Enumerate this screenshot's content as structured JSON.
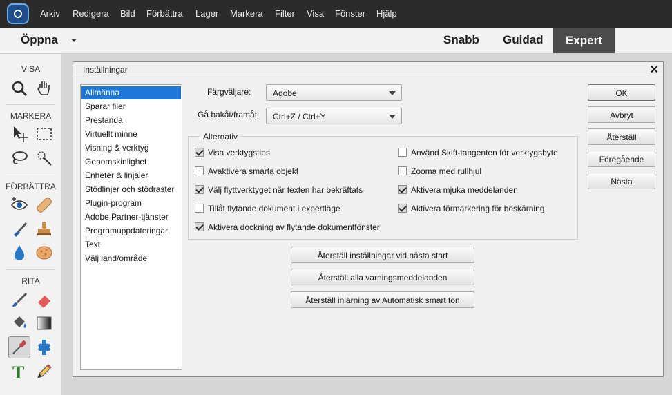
{
  "menubar": {
    "items": [
      "Arkiv",
      "Redigera",
      "Bild",
      "Förbättra",
      "Lager",
      "Markera",
      "Filter",
      "Visa",
      "Fönster",
      "Hjälp"
    ]
  },
  "modebar": {
    "open_label": "Öppna",
    "tabs": [
      "Snabb",
      "Guidad",
      "Expert"
    ],
    "active_tab": "Expert"
  },
  "toolbar": {
    "sections": [
      "VISA",
      "MARKERA",
      "FÖRBÄTTRA",
      "RITA"
    ],
    "tools": [
      "zoom",
      "hand",
      "move",
      "rectangular-marquee",
      "lasso",
      "quick-selection",
      "red-eye",
      "spot-healing",
      "smart-brush",
      "clone-stamp",
      "blur",
      "sponge",
      "brush",
      "eraser",
      "paint-bucket",
      "gradient",
      "color-picker",
      "custom-shape",
      "type",
      "pencil"
    ],
    "selected_tool": "color-picker"
  },
  "dialog": {
    "title": "Inställningar",
    "categories": [
      "Allmänna",
      "Sparar filer",
      "Prestanda",
      "Virtuellt minne",
      "Visning & verktyg",
      "Genomskinlighet",
      "Enheter & linjaler",
      "Stödlinjer och stödraster",
      "Plugin-program",
      "Adobe Partner-tjänster",
      "Programuppdateringar",
      "Text",
      "Välj land/område"
    ],
    "selected_category": "Allmänna",
    "color_picker_label": "Färgväljare:",
    "color_picker_value": "Adobe",
    "undo_label": "Gå bakåt/framåt:",
    "undo_value": "Ctrl+Z / Ctrl+Y",
    "options_title": "Alternativ",
    "options_left": [
      {
        "label": "Visa verktygstips",
        "checked": true
      },
      {
        "label": "Avaktivera smarta objekt",
        "checked": false
      },
      {
        "label": "Välj flyttverktyget när texten har bekräftats",
        "checked": true
      },
      {
        "label": "Tillåt flytande dokument i expertläge",
        "checked": false
      },
      {
        "label": "Aktivera dockning av flytande dokumentfönster",
        "checked": true
      }
    ],
    "options_right": [
      {
        "label": "Använd Skift-tangenten för verktygsbyte",
        "checked": false
      },
      {
        "label": "Zooma med rullhjul",
        "checked": false
      },
      {
        "label": "Aktivera mjuka meddelanden",
        "checked": true
      },
      {
        "label": "Aktivera förmarkering för beskärning",
        "checked": true
      }
    ],
    "reset_buttons": [
      "Återställ inställningar vid nästa start",
      "Återställ alla varningsmeddelanden",
      "Återställ inlärning av Automatisk smart ton"
    ],
    "side_buttons": [
      "OK",
      "Avbryt",
      "Återställ",
      "Föregående",
      "Nästa"
    ],
    "close_glyph": "✕"
  }
}
